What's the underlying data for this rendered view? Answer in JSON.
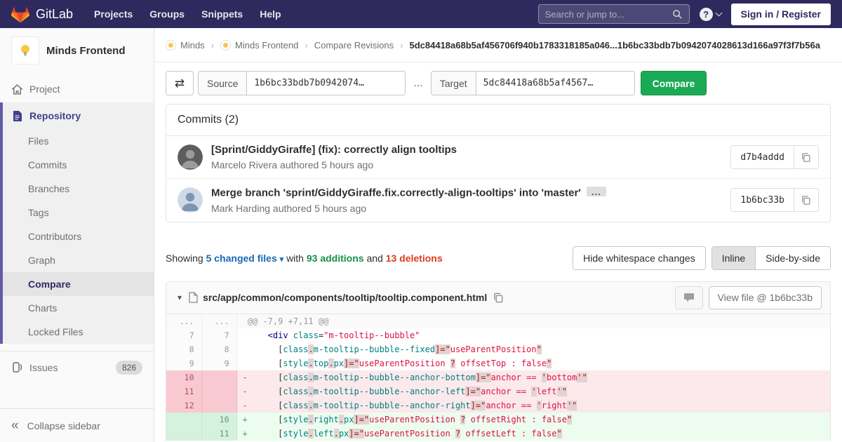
{
  "navbar": {
    "logo_text": "GitLab",
    "menu": [
      "Projects",
      "Groups",
      "Snippets",
      "Help"
    ],
    "search_placeholder": "Search or jump to...",
    "help_glyph": "?",
    "sign_in_label": "Sign in / Register"
  },
  "sidebar": {
    "project_name": "Minds Frontend",
    "project_item": "Project",
    "repo_label": "Repository",
    "repo_items": [
      "Files",
      "Commits",
      "Branches",
      "Tags",
      "Contributors",
      "Graph",
      "Compare",
      "Charts",
      "Locked Files"
    ],
    "repo_active": "Compare",
    "issues_label": "Issues",
    "issues_count": "826",
    "collapse_glyph": "«",
    "collapse_label": "Collapse sidebar"
  },
  "breadcrumb": {
    "links": [
      {
        "label": "Minds",
        "avatar": true
      },
      {
        "label": "Minds Frontend",
        "avatar": true
      },
      {
        "label": "Compare Revisions",
        "avatar": false
      }
    ],
    "separator": "›",
    "current": "5dc84418a68b5af456706f940b1783318185a046...1b6bc33bdb7b0942074028613d166a97f3f7b56a"
  },
  "compare_form": {
    "swap_glyph": "⇄",
    "source_label": "Source",
    "source_value": "1b6bc33bdb7b0942074…",
    "separator": "...",
    "target_label": "Target",
    "target_value": "5dc84418a68b5af4567…",
    "compare_label": "Compare"
  },
  "commits": {
    "header": "Commits (2)",
    "items": [
      {
        "title": "[Sprint/GiddyGiraffe] (fix): correctly align tooltips",
        "expander": false,
        "expander_glyph": "",
        "author_line": "Marcelo Rivera authored 5 hours ago",
        "sha": "d7b4addd"
      },
      {
        "title": "Merge branch 'sprint/GiddyGiraffe.fix.correctly-align-tooltips' into 'master'",
        "expander": true,
        "expander_glyph": "...",
        "author_line": "Mark Harding authored 5 hours ago",
        "sha": "1b6bc33b"
      }
    ]
  },
  "summary": {
    "showing": "Showing",
    "files_link": "5 changed files",
    "caret_glyph": "▾",
    "with_text": "with",
    "additions": "93 additions",
    "and_text": "and",
    "deletions": "13 deletions",
    "hide_whitespace_label": "Hide whitespace changes",
    "inline_label": "Inline",
    "side_by_side_label": "Side-by-side"
  },
  "diff_file": {
    "caret_glyph": "▾",
    "path": "src/app/common/components/tooltip/tooltip.component.html",
    "view_file_label": "View file @ 1b6bc33b",
    "lines": [
      {
        "type": "match",
        "old": "...",
        "new": "...",
        "sign": "",
        "segments": [
          [
            "hunk",
            " @@ -7,9 +7,11 @@"
          ]
        ]
      },
      {
        "type": "ctx",
        "old": "7",
        "new": "7",
        "sign": " ",
        "segments": [
          [
            "pl",
            "    "
          ],
          [
            "nt",
            "<div"
          ],
          [
            "pl",
            " "
          ],
          [
            "na",
            "class"
          ],
          [
            "pl",
            "="
          ],
          [
            "s",
            "\"m-tooltip--bubble\""
          ]
        ]
      },
      {
        "type": "ctx",
        "old": "8",
        "new": "8",
        "sign": " ",
        "segments": [
          [
            "pl",
            "      ["
          ],
          [
            "na",
            "class"
          ],
          [
            "err",
            "."
          ],
          [
            "na",
            "m-tooltip--bubble--fixed"
          ],
          [
            "err",
            "]=\""
          ],
          [
            "s",
            "useParentPosition"
          ],
          [
            "err",
            "\""
          ]
        ]
      },
      {
        "type": "ctx",
        "old": "9",
        "new": "9",
        "sign": " ",
        "segments": [
          [
            "pl",
            "      ["
          ],
          [
            "na",
            "style"
          ],
          [
            "err",
            "."
          ],
          [
            "na",
            "top"
          ],
          [
            "err",
            "."
          ],
          [
            "na",
            "px"
          ],
          [
            "err",
            "]=\""
          ],
          [
            "s",
            "useParentPosition "
          ],
          [
            "err",
            "?"
          ],
          [
            "s",
            " offsetTop : false"
          ],
          [
            "err",
            "\""
          ]
        ]
      },
      {
        "type": "del",
        "old": "10",
        "new": "",
        "sign": "-",
        "segments": [
          [
            "pl",
            "      ["
          ],
          [
            "na",
            "class"
          ],
          [
            "err",
            "."
          ],
          [
            "na",
            "m-tooltip--bubble--anchor-bottom"
          ],
          [
            "err",
            "]=\""
          ],
          [
            "s",
            "anchor == "
          ],
          [
            "err",
            "'"
          ],
          [
            "s",
            "bottom"
          ],
          [
            "err",
            "'\""
          ]
        ]
      },
      {
        "type": "del",
        "old": "11",
        "new": "",
        "sign": "-",
        "segments": [
          [
            "pl",
            "      ["
          ],
          [
            "na",
            "class"
          ],
          [
            "err",
            "."
          ],
          [
            "na",
            "m-tooltip--bubble--anchor-left"
          ],
          [
            "err",
            "]=\""
          ],
          [
            "s",
            "anchor == "
          ],
          [
            "err",
            "'"
          ],
          [
            "s",
            "left"
          ],
          [
            "err",
            "'\""
          ]
        ]
      },
      {
        "type": "del",
        "old": "12",
        "new": "",
        "sign": "-",
        "segments": [
          [
            "pl",
            "      ["
          ],
          [
            "na",
            "class"
          ],
          [
            "err",
            "."
          ],
          [
            "na",
            "m-tooltip--bubble--anchor-right"
          ],
          [
            "err",
            "]=\""
          ],
          [
            "s",
            "anchor == "
          ],
          [
            "err",
            "'"
          ],
          [
            "s",
            "right"
          ],
          [
            "err",
            "'\""
          ]
        ]
      },
      {
        "type": "add",
        "old": "",
        "new": "10",
        "sign": "+",
        "segments": [
          [
            "pl",
            "      ["
          ],
          [
            "na",
            "style"
          ],
          [
            "err",
            "."
          ],
          [
            "na",
            "right"
          ],
          [
            "err",
            "."
          ],
          [
            "na",
            "px"
          ],
          [
            "err",
            "]=\""
          ],
          [
            "s",
            "useParentPosition "
          ],
          [
            "err",
            "?"
          ],
          [
            "s",
            " offsetRight : false"
          ],
          [
            "err",
            "\""
          ]
        ]
      },
      {
        "type": "add",
        "old": "",
        "new": "11",
        "sign": "+",
        "segments": [
          [
            "pl",
            "      ["
          ],
          [
            "na",
            "style"
          ],
          [
            "err",
            "."
          ],
          [
            "na",
            "left"
          ],
          [
            "err",
            "."
          ],
          [
            "na",
            "px"
          ],
          [
            "err",
            "]=\""
          ],
          [
            "s",
            "useParentPosition "
          ],
          [
            "err",
            "?"
          ],
          [
            "s",
            " offsetLeft : false"
          ],
          [
            "err",
            "\""
          ]
        ]
      }
    ]
  },
  "colors": {
    "navbar_bg": "#2e2a5e",
    "button_green": "#1aaa55",
    "link_blue": "#1b69b6",
    "addition_green": "#168f48",
    "deletion_red": "#db3b21",
    "sidebar_active_purple": "#605ca8"
  }
}
